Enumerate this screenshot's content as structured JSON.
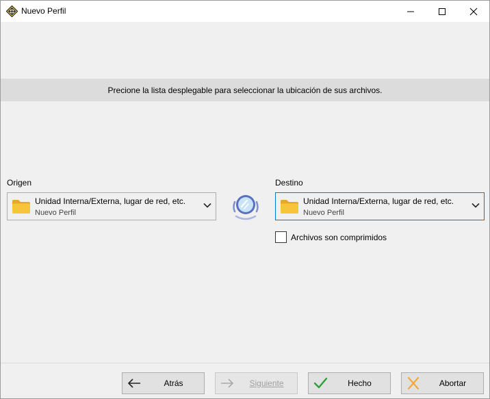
{
  "window": {
    "title": "Nuevo Perfil"
  },
  "banner": {
    "text": "Precione la lista desplegable para seleccionar la ubicación de sus archivos."
  },
  "origin": {
    "label": "Origen",
    "selected_main": "Unidad Interna/Externa, lugar de red, etc.",
    "selected_sub": "Nuevo Perfil"
  },
  "destination": {
    "label": "Destino",
    "selected_main": "Unidad Interna/Externa, lugar de red, etc.",
    "selected_sub": "Nuevo Perfil",
    "compressed_label": "Archivos son comprimidos",
    "compressed_checked": false
  },
  "buttons": {
    "back": "Atrás",
    "next": "Siguiente",
    "done": "Hecho",
    "abort": "Abortar"
  },
  "colors": {
    "accent": "#0078d7",
    "folder": "#f8c53a",
    "check_green": "#2e9e3a",
    "abort_orange": "#f2a83a",
    "sync": "#7a8fd0"
  }
}
